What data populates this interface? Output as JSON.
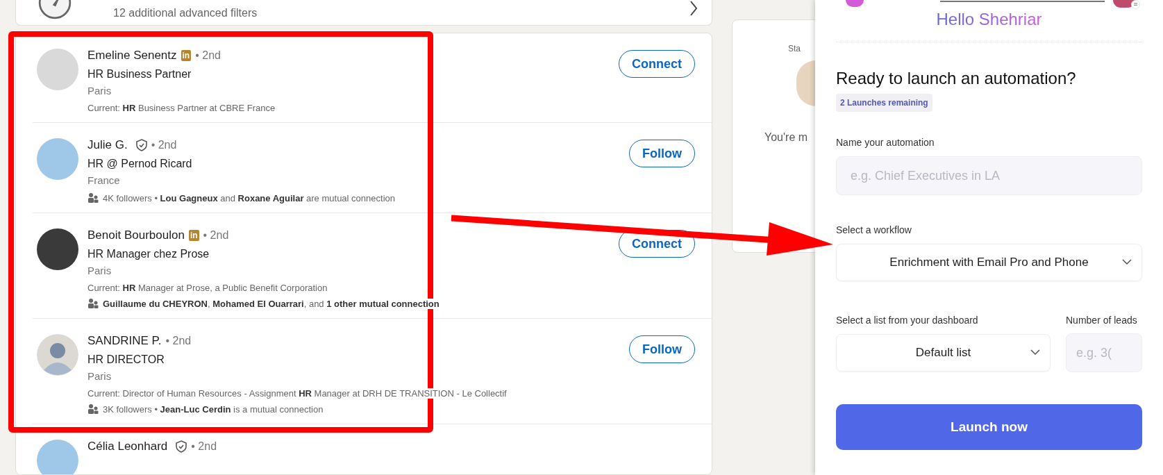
{
  "filters_bar": {
    "text": "12 additional advanced filters"
  },
  "results": [
    {
      "name": "Emeline Senentz",
      "kind": "photo",
      "badge": {
        "kind": "premium",
        "text": "in"
      },
      "degree": "• 2nd",
      "headline": "HR Business Partner",
      "location": "Paris",
      "details": [
        {
          "kind": "current",
          "text": "Current: **HR** Business Partner at CBRE France"
        }
      ],
      "action": "Connect"
    },
    {
      "name": "Julie G.",
      "kind": "photo",
      "badge": {
        "kind": "verified"
      },
      "degree": "• 2nd",
      "headline": "HR @ Pernod Ricard",
      "location": "France",
      "details": [
        {
          "kind": "mutual",
          "text": "4K followers • **Lou Gagneux** and **Roxane Aguilar** are mutual connection"
        }
      ],
      "action": "Follow"
    },
    {
      "name": "Benoit Bourboulon",
      "kind": "photo",
      "badge": {
        "kind": "premium",
        "text": "in"
      },
      "degree": "• 2nd",
      "headline": "HR Manager chez Prose",
      "location": "Paris",
      "details": [
        {
          "kind": "current",
          "text": "Current: **HR** Manager at Prose, a Public Benefit Corporation"
        },
        {
          "kind": "mutual",
          "text": "**Guillaume du CHEYRON**, **Mohamed El Ouarrari**, and **1 other mutual connection**"
        }
      ],
      "action": "Connect"
    },
    {
      "name": "SANDRINE P.",
      "kind": "placeholder",
      "badge": {
        "kind": "none"
      },
      "degree": "• 2nd",
      "headline": "HR DIRECTOR",
      "location": "Paris",
      "details": [
        {
          "kind": "current",
          "text": "Current: Director of Human Resources - Assignment **HR** Manager at DRH DE TRANSITION - Le Collectif"
        },
        {
          "kind": "mutual",
          "text": "3K followers • **Jean-Luc Cerdin** is a mutual connection"
        }
      ],
      "action": "Follow"
    },
    {
      "name": "Célia Leonhard",
      "kind": "photo",
      "badge": {
        "kind": "verified"
      },
      "degree": "• 2nd"
    }
  ],
  "side_card": {
    "line_1": "Sta",
    "line_2": "You're m"
  },
  "panel": {
    "greeting": "Hello Shehriar",
    "heading": "Ready to launch an automation?",
    "badge": "2 Launches remaining",
    "name_label": "Name your automation",
    "name_placeholder": "e.g. Chief Executives in LA",
    "workflow_label": "Select a workflow",
    "workflow_value": "Enrichment with Email Pro and Phone",
    "list_label": "Select a list from your dashboard",
    "list_value": "Default list",
    "leads_label": "Number of leads",
    "leads_placeholder": "e.g. 3(",
    "button": "Launch now"
  }
}
